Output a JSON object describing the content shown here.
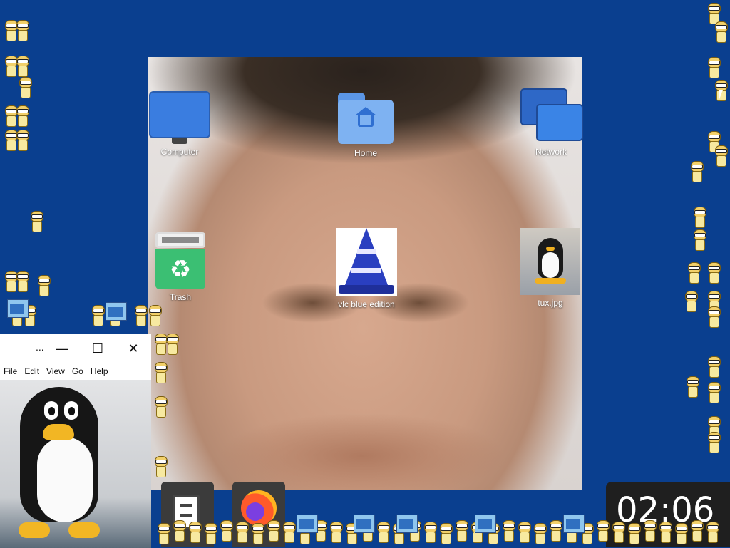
{
  "desktop": {
    "icons": [
      {
        "label": "Computer"
      },
      {
        "label": "Home"
      },
      {
        "label": "Network"
      },
      {
        "label": "Trash"
      },
      {
        "label": "vlc blue edition"
      },
      {
        "label": "tux.jpg"
      }
    ]
  },
  "file_manager": {
    "title": "...",
    "menu": [
      "File",
      "Edit",
      "View",
      "Go",
      "Help"
    ],
    "controls": {
      "minimize": "—",
      "maximize": "☐",
      "close": "✕"
    }
  },
  "dock": {
    "items": [
      "file-cabinet-icon",
      "firefox-icon"
    ]
  },
  "clock": {
    "time": "02:06"
  },
  "colors": {
    "desktop_bg": "#0a3f8f",
    "dock_bg": "#3b3b3b",
    "clock_bg": "#1f1f1f"
  }
}
